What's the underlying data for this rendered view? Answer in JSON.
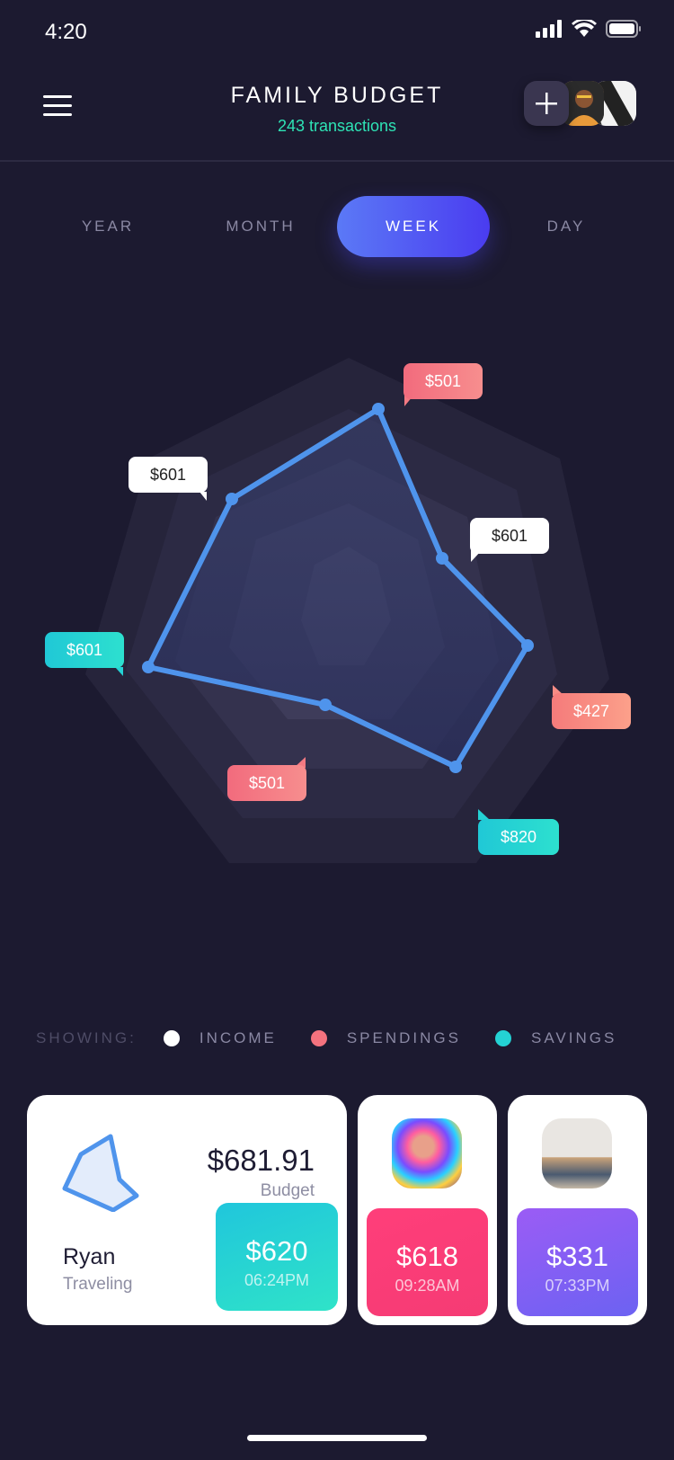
{
  "status_bar": {
    "time": "4:20"
  },
  "header": {
    "title": "FAMILY BUDGET",
    "subtitle": "243 transactions",
    "add_label": "+"
  },
  "tabs": [
    {
      "label": "YEAR",
      "active": false
    },
    {
      "label": "MONTH",
      "active": false
    },
    {
      "label": "WEEK",
      "active": true
    },
    {
      "label": "DAY",
      "active": false
    }
  ],
  "chart": {
    "type": "radar",
    "labels": [
      {
        "text": "$501",
        "series": "spendings"
      },
      {
        "text": "$601",
        "series": "income"
      },
      {
        "text": "$601",
        "series": "income"
      },
      {
        "text": "$601",
        "series": "savings"
      },
      {
        "text": "$427",
        "series": "spendings"
      },
      {
        "text": "$501",
        "series": "spendings"
      },
      {
        "text": "$820",
        "series": "savings"
      }
    ]
  },
  "legend": {
    "label": "SHOWING:",
    "items": [
      {
        "text": "INCOME",
        "color": "#ffffff"
      },
      {
        "text": "SPENDINGS",
        "color": "#f4727e"
      },
      {
        "text": "SAVINGS",
        "color": "#24d2d4"
      }
    ]
  },
  "cards": {
    "ryan": {
      "amount": "$681.91",
      "amount_label": "Budget",
      "name": "Ryan",
      "activity": "Traveling",
      "tile_value": "$620",
      "tile_time": "06:24PM"
    },
    "second": {
      "value": "$618",
      "time": "09:28AM"
    },
    "third": {
      "value": "$331",
      "time": "07:33PM"
    }
  },
  "colors": {
    "background": "#1c1a30",
    "accent": "#4a3cf0",
    "line": "#4f94ec",
    "subtitle": "#2ee3b5"
  }
}
